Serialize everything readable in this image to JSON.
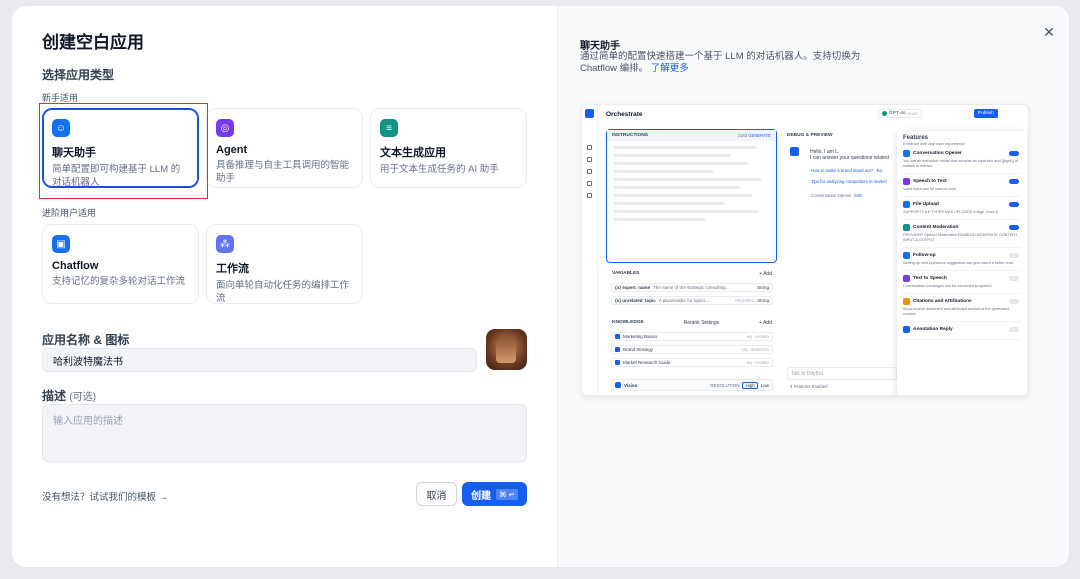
{
  "dialog": {
    "title": "创建空白应用",
    "type_section": "选择应用类型",
    "beginner_group": "新手适用",
    "advanced_group": "进阶用户适用",
    "cards": [
      {
        "title": "聊天助手",
        "desc": "简单配置即可构建基于 LLM 的对话机器人",
        "color": "#1570ef",
        "icon": "chat-bot-icon",
        "selected": true
      },
      {
        "title": "Agent",
        "desc": "具备推理与自主工具调用的智能助手",
        "color": "#7839ee",
        "icon": "agent-icon"
      },
      {
        "title": "文本生成应用",
        "desc": "用于文本生成任务的 AI 助手",
        "color": "#0e9384",
        "icon": "text-generator-icon"
      },
      {
        "title": "Chatflow",
        "desc": "支持记忆的复杂多轮对话工作流",
        "color": "#1570ef",
        "icon": "chatflow-icon"
      },
      {
        "title": "工作流",
        "desc": "面向单轮自动化任务的编排工作流",
        "color": "#6172f3",
        "icon": "workflow-icon"
      }
    ],
    "name_label": "应用名称 & 图标",
    "name_value": "哈利波特魔法书",
    "desc_label": "描述",
    "desc_optional": "(可选)",
    "desc_placeholder": "输入应用的描述",
    "template_link": "没有想法？试试我们的模板 →",
    "cancel": "取消",
    "create": "创建",
    "create_kbd": "⌘ ↵"
  },
  "preview": {
    "title": "聊天助手",
    "desc": "通过简单的配置快速搭建一个基于 LLM 的对话机器人。支持切换为 Chatflow 编排。",
    "learn_more": "了解更多",
    "mock": {
      "header": "Orchestrate",
      "model": "GPT-4o",
      "model_tag": "CHAT",
      "publish": "Publish",
      "instructions": "INSTRUCTIONS",
      "instructions_count": "2182",
      "generate": "GENERATE",
      "debug": "DEBUG & PREVIEW",
      "greeting1": "Hello, I am L.",
      "greeting2": "I can answer your questions related",
      "sugg1": "How to make a brand stand out?",
      "sugg1_tail": "Bo",
      "sugg2": "Tips for analyzing competitors in market",
      "conv_opener": "Conversation Opener",
      "edit": "Edit",
      "variables": "VARIABLES",
      "add": "+ Add",
      "vars": [
        {
          "name": "{x} expert_name",
          "desc": "The name of the strategic consulting...",
          "type": "String"
        },
        {
          "name": "{x} unrelated_topic",
          "desc": "A placeholder for topics...",
          "tag": "REQUIRED",
          "type": "String"
        }
      ],
      "knowledge": "KNOWLEDGE",
      "rerank": "Rerank Settings",
      "docs": [
        {
          "name": "Marketing Basics",
          "tag": "HQ · HYBRID"
        },
        {
          "name": "Brand Strategy",
          "tag": "HQ · INVERTED"
        },
        {
          "name": "Market Research Guide",
          "tag": "HQ · HYBRID"
        }
      ],
      "vision": "Vision",
      "resolution": "RESOLUTION",
      "high": "High",
      "low": "Low",
      "talk": "Talk to DifyBot",
      "features_enabled": "4 Features Enabled",
      "features_title": "Features",
      "features_sub": "Enhance web app user experience",
      "features": [
        {
          "name": "Conversation Opener",
          "desc": "You are an extractive model that accepts an input text and {{type}} of entities to extract.",
          "color": "#1570ef",
          "on": true
        },
        {
          "name": "Speech to Text",
          "desc": "Voice input can be used in chat.",
          "color": "#7839ee",
          "on": true
        },
        {
          "name": "File Upload",
          "desc": "SUPPORT FILE TYPES  MAX UPLOADS  Image, Docs  5",
          "color": "#1570ef",
          "on": true
        },
        {
          "name": "Content Moderation",
          "desc": "PROVIDER  OpenAI Moderation   ENABLED MODERATE CONTENT  INPUT & OUTPUT",
          "color": "#0e9384",
          "on": true
        },
        {
          "name": "Follow-up",
          "desc": "Setting up next questions suggestion can give users a better chat.",
          "color": "#1570ef",
          "on": false
        },
        {
          "name": "Text to Speech",
          "desc": "Conversation messages can be converted to speech.",
          "color": "#7839ee",
          "on": false
        },
        {
          "name": "Citations and Attributions",
          "desc": "Show source document and attributed section of the generated content.",
          "color": "#f79009",
          "on": false
        },
        {
          "name": "Annotation Reply",
          "desc": "",
          "color": "#155eef",
          "on": false
        }
      ]
    }
  }
}
